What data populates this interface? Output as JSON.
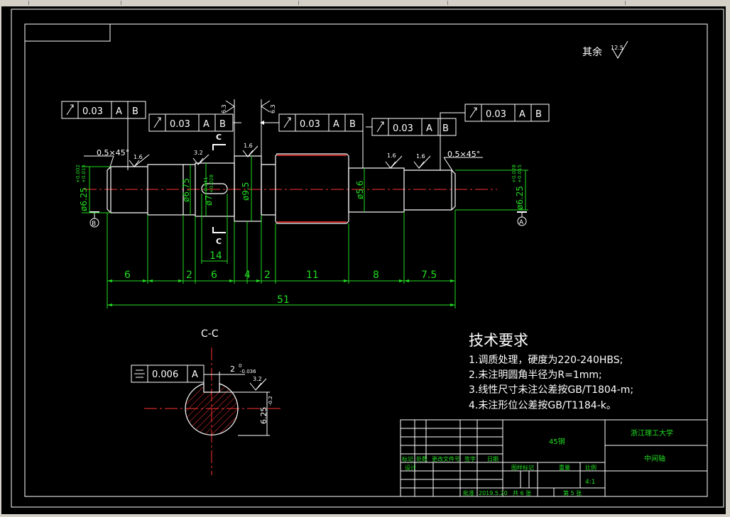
{
  "drawing": {
    "roughness_note": {
      "label": "其余",
      "value": "12.5"
    },
    "fcf": [
      {
        "id": "fcf-far-left",
        "tolerance": "0.03",
        "datums": [
          "A",
          "B"
        ]
      },
      {
        "id": "fcf-left",
        "tolerance": "0.03",
        "datums": [
          "A",
          "B"
        ]
      },
      {
        "id": "fcf-mid",
        "tolerance": "0.03",
        "datums": [
          "A",
          "B"
        ]
      },
      {
        "id": "fcf-right",
        "tolerance": "0.03",
        "datums": [
          "A",
          "B"
        ]
      },
      {
        "id": "fcf-far-right",
        "tolerance": "0.03",
        "datums": [
          "A",
          "B"
        ]
      }
    ],
    "section_fcf": {
      "tolerance": "0.006",
      "datums": [
        "A"
      ]
    },
    "chamfer_left": "0.5×45°",
    "chamfer_right": "0.5×45°",
    "roughness_marks": [
      "1.6",
      "1.6",
      "3.2",
      "1.6",
      "1.6",
      "1.6",
      "6.3",
      "6.3"
    ],
    "section_marker": "C",
    "section_title": "C-C",
    "datum_left": "B",
    "datum_right": "A",
    "diameters": {
      "left_end": "ø6.25",
      "left_end_tol_upper": "+0.002",
      "left_end_tol_lower": "+0.015",
      "step_1": "ø6.75",
      "keyway_seat": "ø7",
      "keyway_seat_tol_upper": "-0.041",
      "keyway_seat_tol_lower": "+0.028",
      "collar": "ø9.5",
      "right_step": "ø5.6",
      "right_end": "ø6.25",
      "right_end_tol_upper": "+0.028",
      "right_end_tol_lower": "+0.015"
    },
    "keyway_width": "14",
    "lengths": [
      "6",
      "2",
      "6",
      "4",
      "2",
      "11",
      "8",
      "7.5"
    ],
    "overall_length": "51",
    "section_dims": {
      "key_width": "2",
      "key_width_tol": "-0.036",
      "key_depth": "0",
      "roughness": "3.2",
      "diameter": "6.25",
      "diameter_tol": "-0.2"
    }
  },
  "technical_requirements": {
    "title": "技术要求",
    "items": [
      "1.调质处理，硬度为220-240HBS;",
      "2.未注明圆角半径为R=1mm;",
      "3.线性尺寸未注公差按GB/T1804-m;",
      "4.未注形位公差按GB/T1184-k。"
    ]
  },
  "title_block": {
    "material": "45钢",
    "school": "浙江理工大学",
    "part_name": "中间轴",
    "scale": "4:1",
    "scale_label": "比例",
    "weight_label": "重量",
    "stage_label": "图样标记",
    "col_mark": "标记",
    "col_count": "处数",
    "col_file": "更改文件号",
    "col_sign": "签字",
    "col_date": "日期",
    "row_design": "设计",
    "row_approve": "批准",
    "date": "2019.5.20",
    "sheets_total": "共 6 张",
    "sheet_no": "第 5 张"
  }
}
